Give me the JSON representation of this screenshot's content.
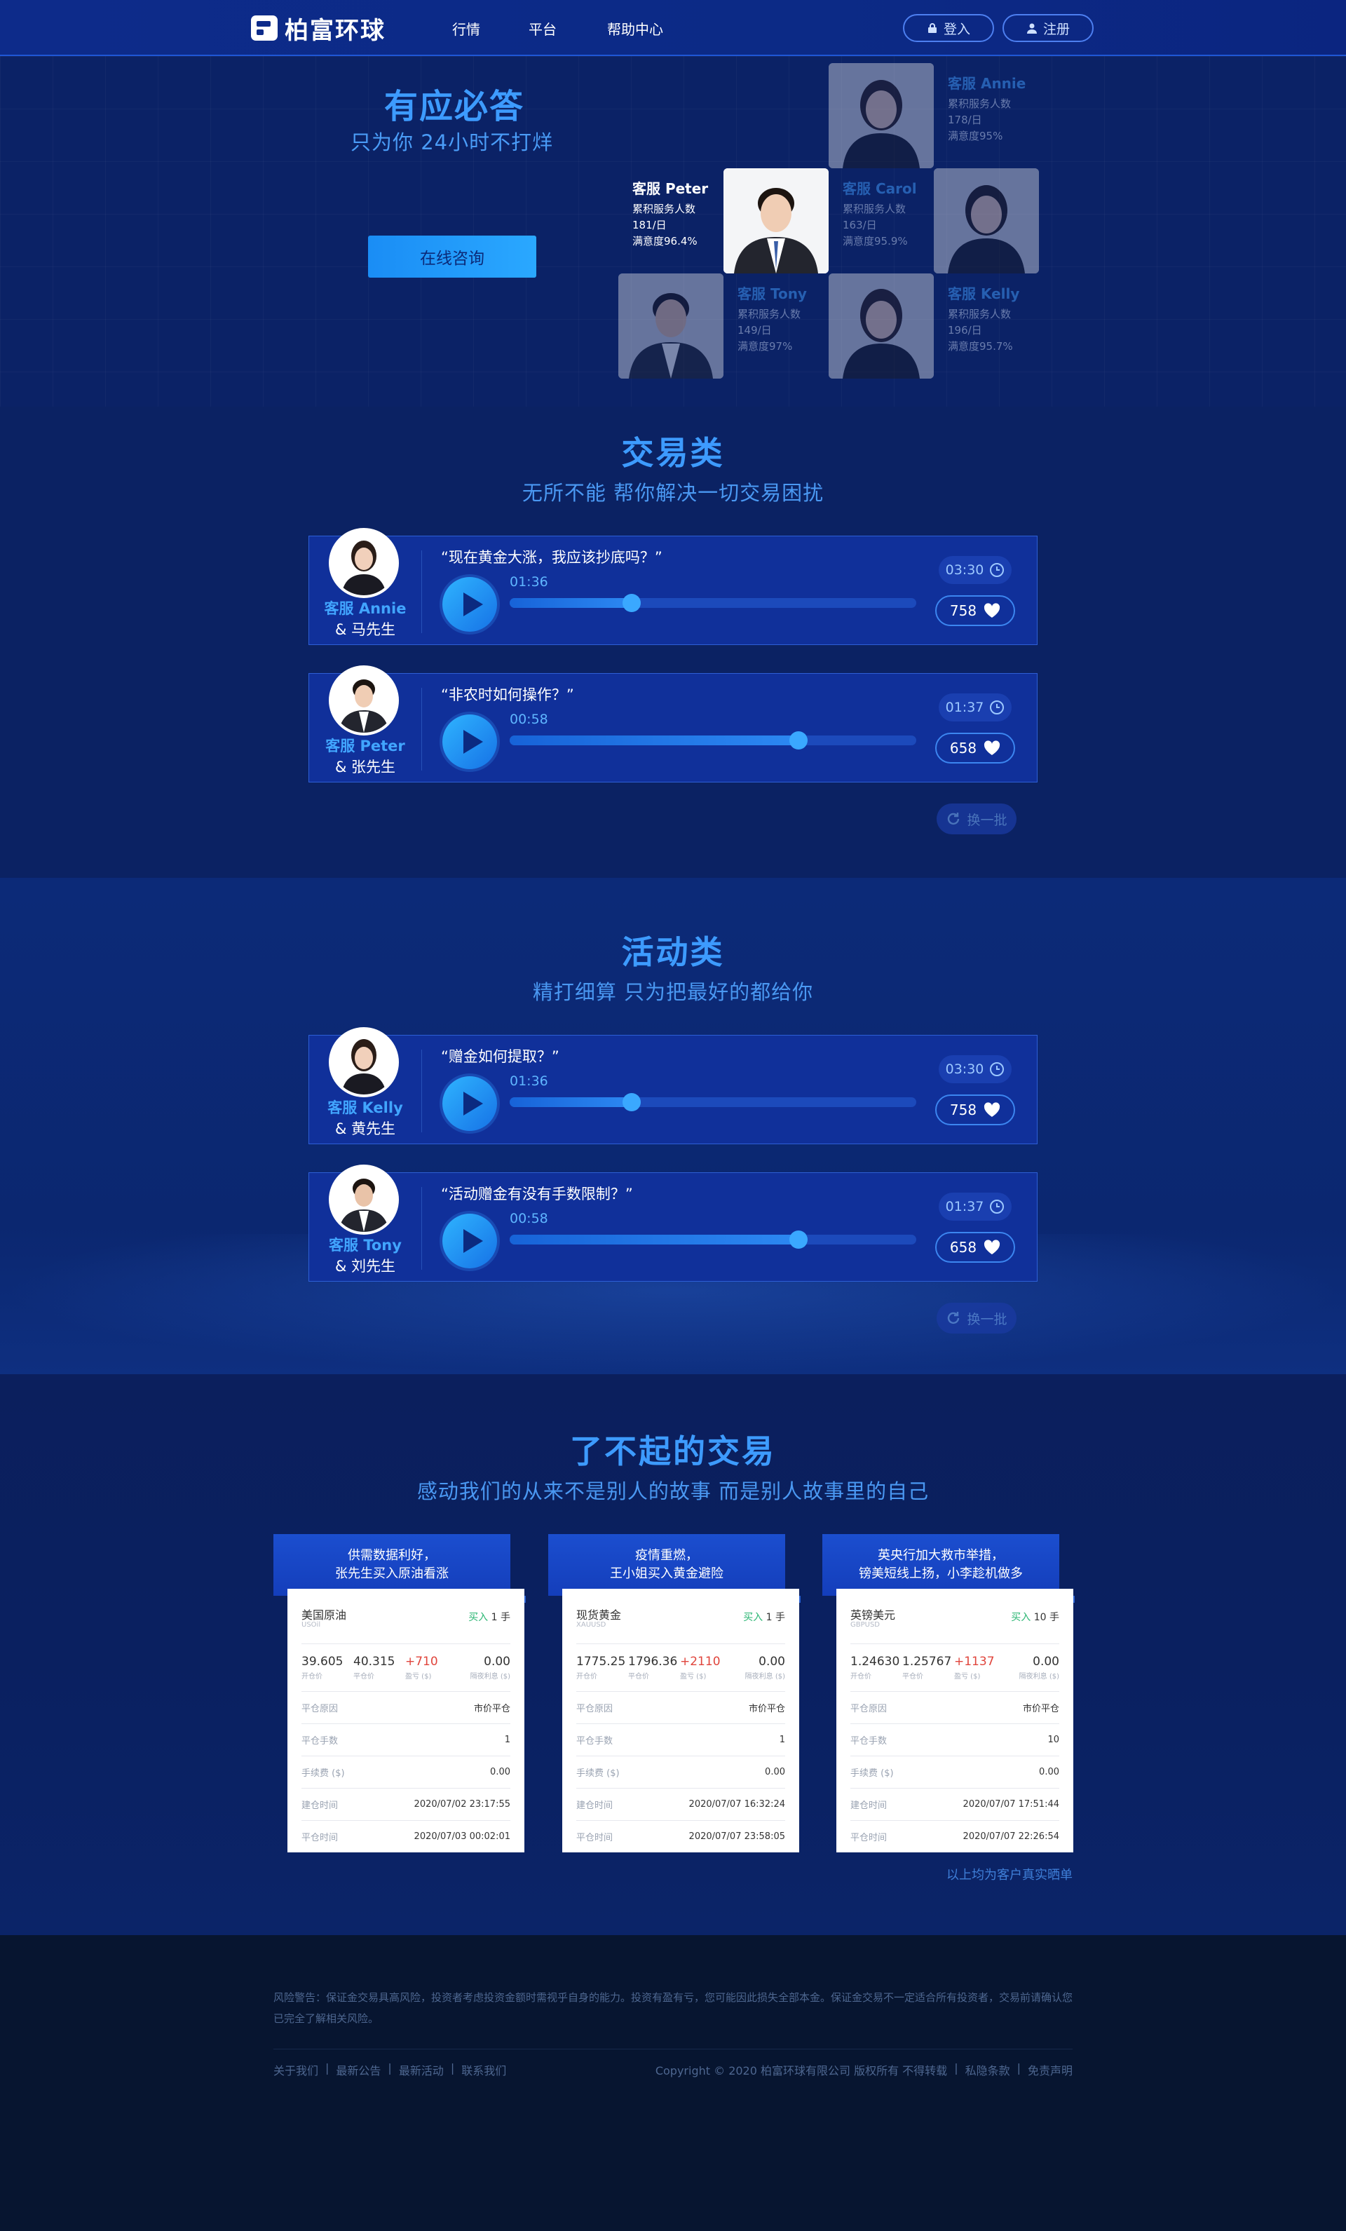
{
  "header": {
    "logo": "柏富环球",
    "nav": [
      "行情",
      "平台",
      "帮助中心"
    ],
    "login": "登入",
    "register": "注册"
  },
  "hero": {
    "title": "有应必答",
    "subtitle": "只为你  24小时不打烊",
    "cta": "在线咨询",
    "agents": [
      {
        "name": "客服 Annie",
        "l1": "累积服务人数",
        "l2": "178/日",
        "l3": "满意度95%"
      },
      {
        "name": "客服 Peter",
        "l1": "累积服务人数",
        "l2": "181/日",
        "l3": "满意度96.4%"
      },
      {
        "name": "客服 Carol",
        "l1": "累积服务人数",
        "l2": "163/日",
        "l3": "满意度95.9%"
      },
      {
        "name": "客服 Tony",
        "l1": "累积服务人数",
        "l2": "149/日",
        "l3": "满意度97%"
      },
      {
        "name": "客服 Kelly",
        "l1": "累积服务人数",
        "l2": "196/日",
        "l3": "满意度95.7%"
      }
    ]
  },
  "trade_section": {
    "title": "交易类",
    "subtitle": "无所不能 帮你解决一切交易困扰",
    "swap": "换一批",
    "items": [
      {
        "agent": "客服 Annie",
        "customer": "& 马先生",
        "question": "“现在黄金大涨，我应该抄底吗？”",
        "time": "01:36",
        "progress": 0.3,
        "duration": "03:30",
        "likes": "758"
      },
      {
        "agent": "客服 Peter",
        "customer": "& 张先生",
        "question": "“非农时如何操作？”",
        "time": "00:58",
        "progress": 0.71,
        "duration": "01:37",
        "likes": "658"
      }
    ]
  },
  "activity_section": {
    "title": "活动类",
    "subtitle": "精打细算 只为把最好的都给你",
    "swap": "换一批",
    "items": [
      {
        "agent": "客服 Kelly",
        "customer": "& 黄先生",
        "question": "“赠金如何提取？”",
        "time": "01:36",
        "progress": 0.3,
        "duration": "03:30",
        "likes": "758"
      },
      {
        "agent": "客服 Tony",
        "customer": "& 刘先生",
        "question": "“活动赠金有没有手数限制？”",
        "time": "00:58",
        "progress": 0.71,
        "duration": "01:37",
        "likes": "658"
      }
    ]
  },
  "great_trades": {
    "title": "了不起的交易",
    "subtitle": "感动我们的从来不是别人的故事 而是别人故事里的自己",
    "note": "以上均为客户真实晒单",
    "cards": [
      {
        "head1": "供需数据利好，",
        "head2": "张先生买入原油看涨",
        "product": "美国原油",
        "code": "USOil",
        "side": "买入",
        "lots": "1 手",
        "open": "39.605",
        "close": "40.315",
        "pnl": "+710",
        "swap": "0.00",
        "open_l": "开仓价",
        "close_l": "平仓价",
        "pnl_l": "盈亏 ($)",
        "swap_l": "隔夜利息 ($)",
        "rows": [
          [
            "平仓原因",
            "市价平仓"
          ],
          [
            "平仓手数",
            "1"
          ],
          [
            "手续费 ($)",
            "0.00"
          ],
          [
            "建仓时间",
            "2020/07/02 23:17:55"
          ],
          [
            "平仓时间",
            "2020/07/03 00:02:01"
          ]
        ]
      },
      {
        "head1": "疫情重燃，",
        "head2": "王小姐买入黄金避险",
        "product": "现货黄金",
        "code": "XAUUSD",
        "side": "买入",
        "lots": "1 手",
        "open": "1775.25",
        "close": "1796.36",
        "pnl": "+2110",
        "swap": "0.00",
        "open_l": "开仓价",
        "close_l": "平仓价",
        "pnl_l": "盈亏 ($)",
        "swap_l": "隔夜利息 ($)",
        "rows": [
          [
            "平仓原因",
            "市价平仓"
          ],
          [
            "平仓手数",
            "1"
          ],
          [
            "手续费 ($)",
            "0.00"
          ],
          [
            "建仓时间",
            "2020/07/07 16:32:24"
          ],
          [
            "平仓时间",
            "2020/07/07 23:58:05"
          ]
        ]
      },
      {
        "head1": "英央行加大救市举措，",
        "head2": "镑美短线上扬，小李趁机做多",
        "product": "英镑美元",
        "code": "GBPUSD",
        "side": "买入",
        "lots": "10 手",
        "open": "1.24630",
        "close": "1.25767",
        "pnl": "+1137",
        "swap": "0.00",
        "open_l": "开仓价",
        "close_l": "平仓价",
        "pnl_l": "盈亏 ($)",
        "swap_l": "隔夜利息 ($)",
        "rows": [
          [
            "平仓原因",
            "市价平仓"
          ],
          [
            "平仓手数",
            "10"
          ],
          [
            "手续费 ($)",
            "0.00"
          ],
          [
            "建仓时间",
            "2020/07/07 17:51:44"
          ],
          [
            "平仓时间",
            "2020/07/07 22:26:54"
          ]
        ]
      }
    ]
  },
  "footer": {
    "risk": "风险警告：保证金交易具高风险，投资者考虑投资金额时需视乎自身的能力。投资有盈有亏，您可能因此损失全部本金。保证金交易不一定适合所有投资者，交易前请确认您已完全了解相关风险。",
    "links": [
      "关于我们",
      "最新公告",
      "最新活动",
      "联系我们"
    ],
    "copyright": "Copyright © 2020 柏富环球有限公司 版权所有 不得转载",
    "legal": [
      "私隐条款",
      "免责声明"
    ]
  },
  "colors": {
    "accent": "#3d9bff",
    "header": "#0d2b8a",
    "card": "#10309a",
    "pnl": "#e0453c",
    "buy": "#2bb673"
  }
}
